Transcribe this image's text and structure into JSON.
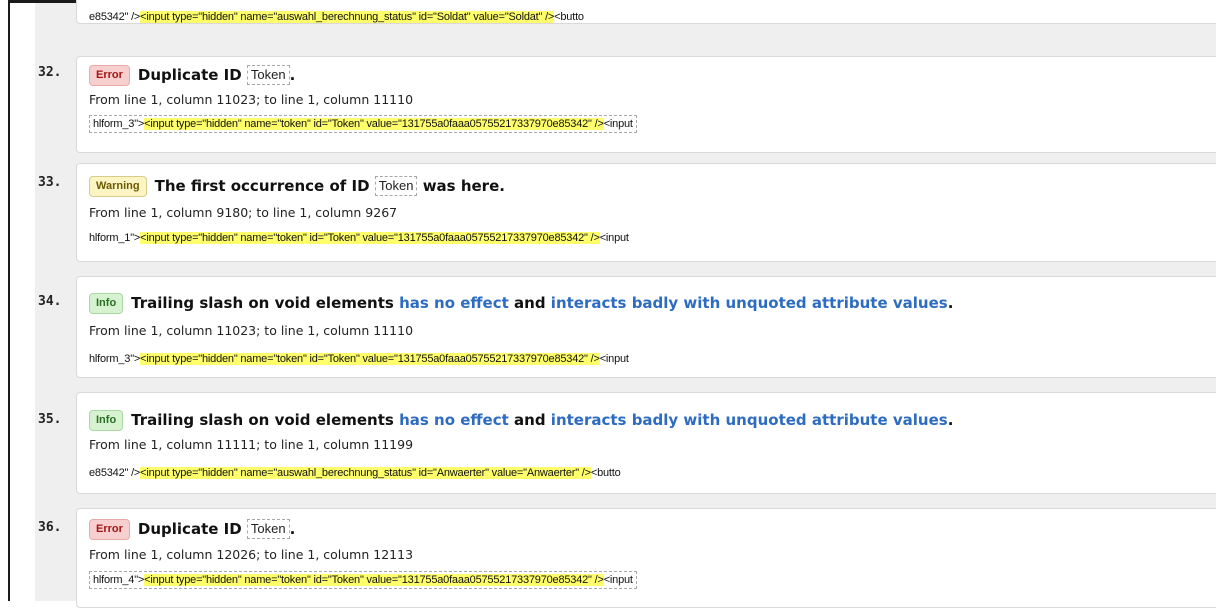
{
  "top_partial": {
    "extract_before": "e85342\" />",
    "extract_highlight": "<input type=\"hidden\" name=\"auswahl_berechnung_status\" id=\"Soldat\" value=\"Soldat\" />",
    "extract_after": "<butto"
  },
  "messages": [
    {
      "number": "32.",
      "badge": "Error",
      "type": "error",
      "title_prefix": "Duplicate ID",
      "code": "Token",
      "title_suffix": ".",
      "location": "From line 1, column 11023; to line 1, column 11110",
      "extract_before": "hlform_3\">",
      "extract_highlight": "<input type=\"hidden\" name=\"token\" id=\"Token\" value=\"131755a0faaa05755217337970e85342\" />",
      "extract_after": "<input"
    },
    {
      "number": "33.",
      "badge": "Warning",
      "type": "warning",
      "title_prefix": "The first occurrence of ID",
      "code": "Token",
      "title_suffix": "was here.",
      "location": "From line 1, column 9180; to line 1, column 9267",
      "extract_before": "hlform_1\">",
      "extract_highlight": "<input type=\"hidden\" name=\"token\" id=\"Token\" value=\"131755a0faaa05755217337970e85342\" />",
      "extract_after": "<input"
    },
    {
      "number": "34.",
      "badge": "Info",
      "type": "info",
      "title_part1": "Trailing slash on void elements",
      "title_link1": "has no effect",
      "title_part2": "and",
      "title_link2": "interacts badly with unquoted attribute values",
      "title_end": ".",
      "location": "From line 1, column 11023; to line 1, column 11110",
      "extract_before": "hlform_3\">",
      "extract_highlight": "<input type=\"hidden\" name=\"token\" id=\"Token\" value=\"131755a0faaa05755217337970e85342\" />",
      "extract_after": "<input"
    },
    {
      "number": "35.",
      "badge": "Info",
      "type": "info",
      "title_part1": "Trailing slash on void elements",
      "title_link1": "has no effect",
      "title_part2": "and",
      "title_link2": "interacts badly with unquoted attribute values",
      "title_end": ".",
      "location": "From line 1, column 11111; to line 1, column 11199",
      "extract_before": "e85342\" />",
      "extract_highlight": "<input type=\"hidden\" name=\"auswahl_berechnung_status\" id=\"Anwaerter\" value=\"Anwaerter\" />",
      "extract_after": "<butto"
    },
    {
      "number": "36.",
      "badge": "Error",
      "type": "error",
      "title_prefix": "Duplicate ID",
      "code": "Token",
      "title_suffix": ".",
      "location": "From line 1, column 12026; to line 1, column 12113",
      "extract_before": "hlform_4\">",
      "extract_highlight": "<input type=\"hidden\" name=\"token\" id=\"Token\" value=\"131755a0faaa05755217337970e85342\" />",
      "extract_after": "<input"
    }
  ],
  "colors": {
    "error_badge_bg": "#f8cfcf",
    "warning_badge_bg": "#fdf4c4",
    "info_badge_bg": "#d6f2d1",
    "link": "#2d6cc0",
    "highlight": "#ffff6b",
    "list_background": "#efefef"
  }
}
